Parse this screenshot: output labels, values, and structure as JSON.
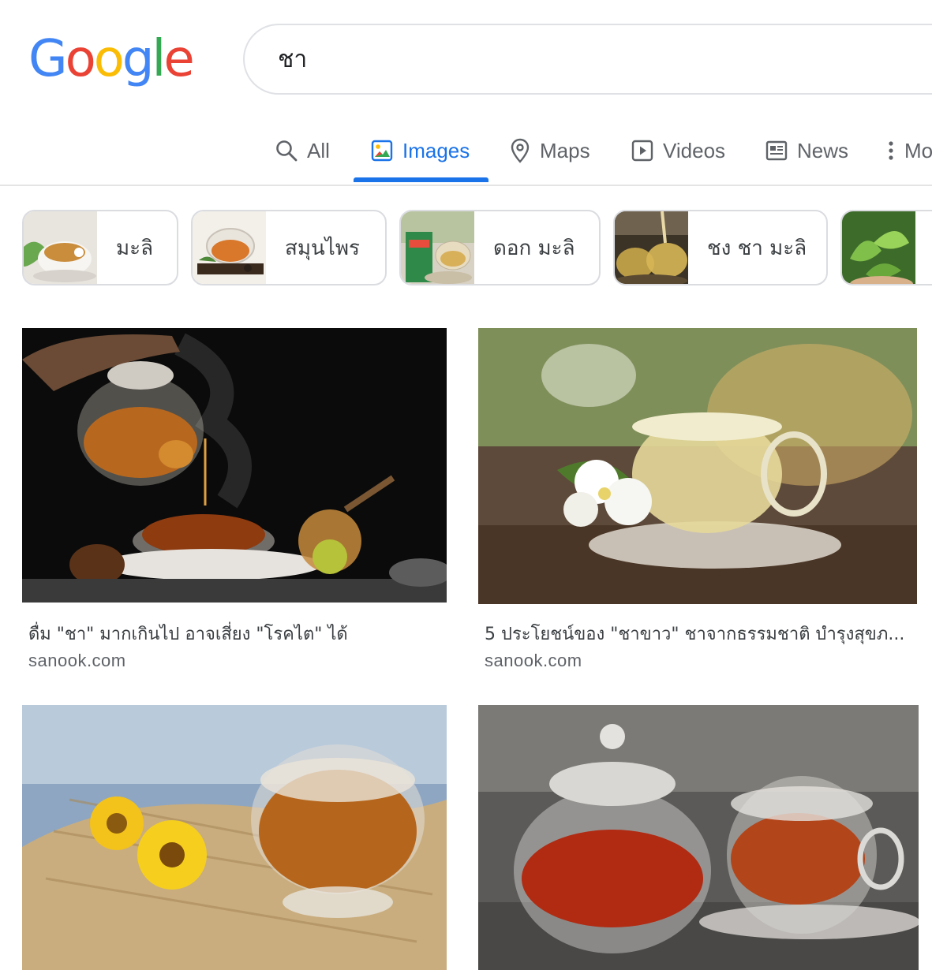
{
  "logo": {
    "letters": [
      "G",
      "o",
      "o",
      "g",
      "l",
      "e"
    ],
    "colors": [
      "#4285f4",
      "#ea4335",
      "#fbbc05",
      "#4285f4",
      "#34a853",
      "#ea4335"
    ]
  },
  "search": {
    "query": "ชา"
  },
  "tabs": [
    {
      "label": "All",
      "icon": "search-icon"
    },
    {
      "label": "Images",
      "icon": "image-icon",
      "active": true
    },
    {
      "label": "Maps",
      "icon": "map-pin-icon"
    },
    {
      "label": "Videos",
      "icon": "play-icon"
    },
    {
      "label": "News",
      "icon": "newspaper-icon"
    },
    {
      "label": "More",
      "icon": "more-vert-icon"
    }
  ],
  "chips": [
    {
      "label": "มะลิ"
    },
    {
      "label": "สมุนไพร"
    },
    {
      "label": "ดอก มะลิ"
    },
    {
      "label": "ชง ชา มะลิ"
    },
    {
      "label": ""
    }
  ],
  "results": [
    {
      "title": "ดื่ม \"ชา\" มากเกินไป อาจเสี่ยง \"โรคไต\" ได้",
      "source": "sanook.com"
    },
    {
      "title": "5 ประโยชน์ของ \"ชาขาว\" ชาจากธรรมชาติ บำรุงสุขภ...",
      "source": "sanook.com"
    },
    {
      "title": "",
      "source": ""
    },
    {
      "title": "",
      "source": ""
    }
  ],
  "colors": {
    "accent": "#1a73e8",
    "muted": "#5f6368",
    "border": "#dadce0"
  }
}
